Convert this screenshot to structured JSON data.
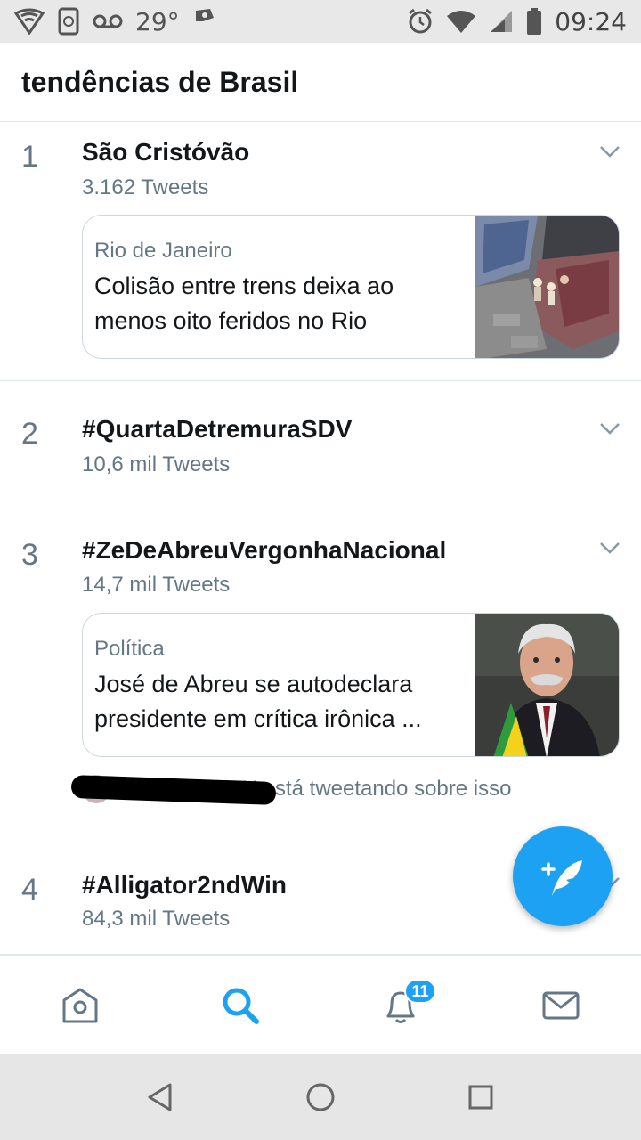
{
  "status_bar": {
    "temperature": "29°",
    "time": "09:24"
  },
  "header": {
    "title": "tendências de Brasil"
  },
  "trends": [
    {
      "rank": "1",
      "name": "São Cristóvão",
      "count": "3.162 Tweets",
      "card": {
        "category": "Rio de Janeiro",
        "headline": "Colisão entre trens deixa ao menos oito feridos no Rio"
      }
    },
    {
      "rank": "2",
      "name": "#QuartaDetremuraSDV",
      "count": "10,6 mil Tweets"
    },
    {
      "rank": "3",
      "name": "#ZeDeAbreuVergonhaNacional",
      "count": "14,7 mil Tweets",
      "card": {
        "category": "Política",
        "headline": "José de Abreu se autodeclara presidente em crítica irônica ..."
      },
      "social_context": "Botho com TU está tweetando sobre isso"
    },
    {
      "rank": "4",
      "name": "#Alligator2ndWin",
      "count": "84,3 mil Tweets"
    }
  ],
  "bottom_nav": {
    "notifications_badge": "11"
  },
  "colors": {
    "accent": "#1da1f2",
    "muted": "#657786",
    "border": "#e1e8ed"
  },
  "icons": [
    "home-icon",
    "search-icon",
    "notifications-icon",
    "messages-icon",
    "compose-tweet-icon",
    "chevron-down-icon",
    "back-icon",
    "home-circle-icon",
    "recents-icon"
  ]
}
